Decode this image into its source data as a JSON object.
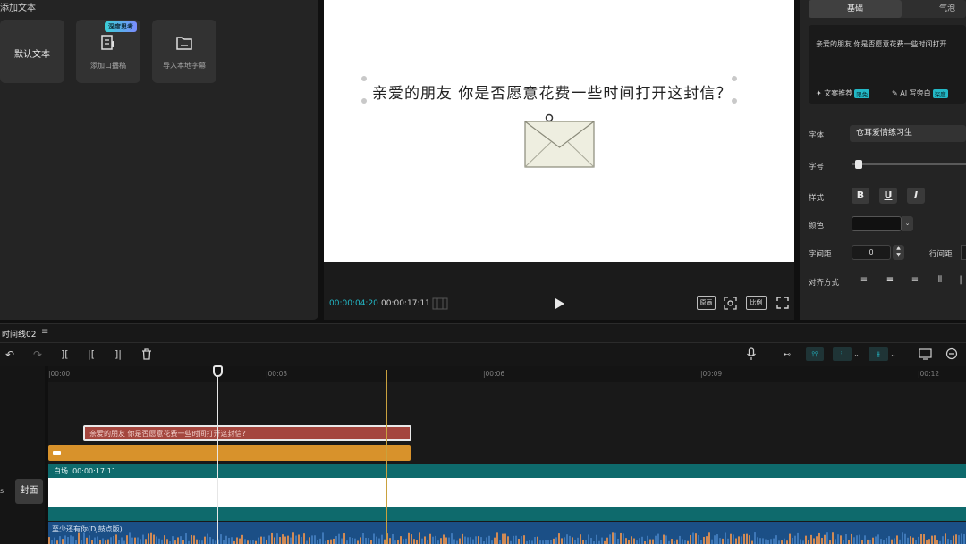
{
  "left_panel": {
    "title": "添加文本",
    "cards": [
      {
        "label": "默认文本",
        "icon": "text-default",
        "badge": ""
      },
      {
        "label": "添加口播稿",
        "icon": "script-icon",
        "badge": "深度思考"
      },
      {
        "label": "导入本地字幕",
        "icon": "folder-icon",
        "badge": ""
      }
    ]
  },
  "player": {
    "caption": "亲爱的朋友 你是否愿意花费一些时间打开这封信？",
    "time_current": "00:00:04:20",
    "time_total": "00:00:17:11",
    "btn_original": "原画",
    "btn_ratio": "比例"
  },
  "right_panel": {
    "tab_basic": "基础",
    "tab_bubble": "气泡",
    "text_value": "亲爱的朋友 你是否愿意花费一些时间打开",
    "recommend": "文案推荐",
    "recommend_badge": "限免",
    "ai_write": "AI 写旁白",
    "ai_badge": "深度",
    "font_label": "字体",
    "font_value": "仓耳爱情练习生",
    "size_label": "字号",
    "size_level": 0.03,
    "style_label": "样式",
    "style_bold": "B",
    "style_underline": "U",
    "style_italic": "I",
    "color_label": "颜色",
    "letter_spacing_label": "字间距",
    "letter_spacing_value": "0",
    "line_spacing_label": "行间距",
    "align_label": "对齐方式"
  },
  "timeline": {
    "name": "时间线02",
    "ticks": [
      "|00:00",
      "|00:03",
      "|00:06",
      "|00:09",
      "|00:12"
    ],
    "text_clip": "亲爱的朋友 你是否愿意花费一些时间打开这封信?",
    "video_clip_name": "白场",
    "video_clip_duration": "00:00:17:11",
    "cover_label": "封面",
    "audio_clip": "至少还有你(DJ鼓点版)"
  },
  "colors": {
    "accent": "#23b8c6",
    "text_clip": "#a4463e",
    "anim_clip": "#d8922b",
    "video_track": "#0e6a6c",
    "audio_track": "#1b4f86"
  }
}
